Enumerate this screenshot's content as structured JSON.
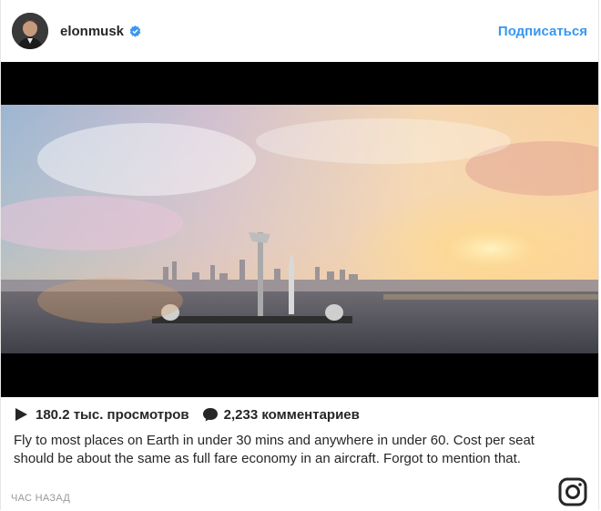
{
  "post": {
    "username": "elonmusk",
    "follow_label": "Подписаться",
    "views": "180.2 тыс. просмотров",
    "comments": "2,233 комментариев",
    "caption": "Fly to most places on Earth in under 30 mins and anywhere in under 60. Cost per seat should be about the same as full fare economy in an aircraft. Forgot to mention that.",
    "timestamp": "ЧАС НАЗАД"
  },
  "icons": {
    "verified": "verified-badge-icon",
    "play": "play-icon",
    "comment": "comment-bubble-icon",
    "instagram": "instagram-logo-icon"
  },
  "colors": {
    "accent": "#3897f0",
    "text": "#262626",
    "muted": "#999999"
  }
}
